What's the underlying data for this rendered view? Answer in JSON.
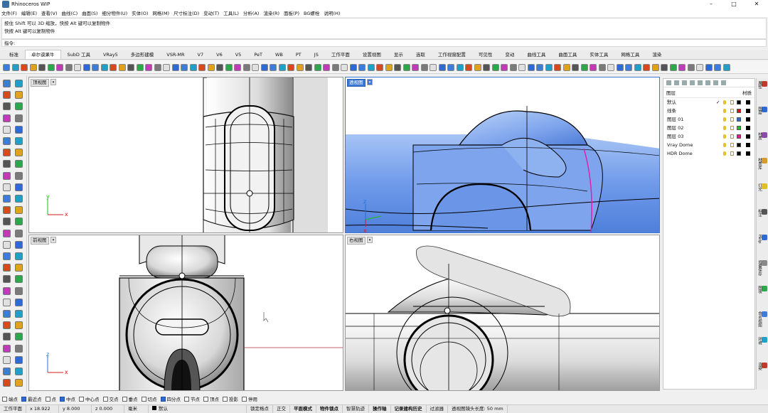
{
  "app": {
    "title": "Rhinoceros WIP",
    "controls": [
      "–",
      "□",
      "✕"
    ]
  },
  "menu": [
    "文件(F)",
    "编辑(E)",
    "查看(V)",
    "曲线(C)",
    "曲面(S)",
    "细分物件(U)",
    "实体(O)",
    "网格(M)",
    "尺寸标注(D)",
    "变动(T)",
    "工具(L)",
    "分析(A)",
    "渲染(R)",
    "面板(P)",
    "BG螺栓",
    "说明(H)"
  ],
  "command_history": [
    "按住 Shift 可以 3D 缩放，快按 Alt 键可以复制物件",
    "快按 Alt 键可以复制物件"
  ],
  "command_prompt": "指令:",
  "tabs": [
    "标准",
    "卓尔谟果牛",
    "SubD 工具",
    "VRay5",
    "多边形建模",
    "VSR-MR",
    "V7",
    "V6",
    "V5",
    "PeT",
    "WB",
    "PT",
    "JS",
    "工作平面",
    "设置视图",
    "显示",
    "选取",
    "工作视窗配置",
    "可见性",
    "变动",
    "曲线工具",
    "曲面工具",
    "实体工具",
    "网格工具",
    "渲染"
  ],
  "active_tab": "卓尔谟果牛",
  "viewports": {
    "top": "顶视图",
    "perspective": "透视图",
    "front": "前视图",
    "right": "右视图"
  },
  "axes": {
    "x": "x",
    "y": "y",
    "z": "z"
  },
  "layers": {
    "header_name": "图层",
    "header_material": "材质",
    "items": [
      {
        "name": "默认",
        "current": "✓",
        "color": "#000000"
      },
      {
        "name": "线条",
        "color": "#e01010"
      },
      {
        "name": "图层 01",
        "color": "#1f6fd6"
      },
      {
        "name": "图层 02",
        "color": "#1fbf2a"
      },
      {
        "name": "图层 03",
        "color": "#e01890"
      },
      {
        "name": "Vray Dome",
        "color": "#000000"
      },
      {
        "name": "HDR Dome",
        "color": "#000000"
      }
    ]
  },
  "right_tabs": [
    "属性",
    "图层",
    "材质",
    "材质库",
    "灯光",
    "标注",
    "Help",
    "增量保存",
    "图块",
    "命名视图",
    "环境",
    "渲染"
  ],
  "osnap": [
    {
      "label": "端点",
      "on": false
    },
    {
      "label": "最近点",
      "on": true
    },
    {
      "label": "点",
      "on": false
    },
    {
      "label": "中点",
      "on": true
    },
    {
      "label": "中心点",
      "on": false
    },
    {
      "label": "交点",
      "on": false
    },
    {
      "label": "垂点",
      "on": false
    },
    {
      "label": "切点",
      "on": false
    },
    {
      "label": "四分点",
      "on": true
    },
    {
      "label": "节点",
      "on": false
    },
    {
      "label": "顶点",
      "on": false
    },
    {
      "label": "投影",
      "on": false
    },
    {
      "label": "停用",
      "on": false
    }
  ],
  "status": {
    "cplane": "工作平面",
    "x": "x 18.922",
    "y": "y 8.000",
    "z": "z 0.000",
    "unit": "毫米",
    "layer": "默认",
    "items": [
      "锁定格点",
      "正交",
      "平面模式",
      "物件锁点",
      "智慧轨迹",
      "操作轴",
      "记录建构历史",
      "过滤器",
      "透视图镜头长度: 50 mm"
    ],
    "bold": [
      "平面模式",
      "物件锁点",
      "操作轴",
      "记录建构历史"
    ]
  }
}
